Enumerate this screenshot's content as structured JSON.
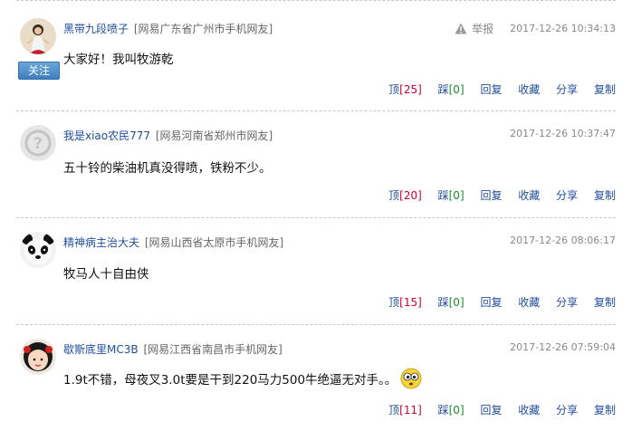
{
  "comments": [
    {
      "username": "黑带九段喷子",
      "location": "[网易广东省广州市手机网友]",
      "timestamp": "2017-12-26 10:34:13",
      "report_label": "举报",
      "follow_label": "关注",
      "text": "大家好！我叫牧游乾",
      "avatar_icon": "dancer-avatar-icon",
      "actions": {
        "up_label": "顶",
        "up_count": "[25]",
        "down_label": "踩",
        "down_count": "[0]",
        "reply_label": "回复",
        "fav_label": "收藏",
        "share_label": "分享",
        "copy_label": "复制"
      }
    },
    {
      "username": "我是xiao农民777",
      "location": "[网易河南省郑州市网友]",
      "timestamp": "2017-12-26 10:37:47",
      "text": "五十铃的柴油机真没得喷，铁粉不少。",
      "avatar_icon": "default-user-avatar-icon",
      "actions": {
        "up_label": "顶",
        "up_count": "[20]",
        "down_label": "踩",
        "down_count": "[0]",
        "reply_label": "回复",
        "fav_label": "收藏",
        "share_label": "分享",
        "copy_label": "复制"
      }
    },
    {
      "username": "精神病主治大夫",
      "location": "[网易山西省太原市手机网友]",
      "timestamp": "2017-12-26 08:06:17",
      "text": "牧马人十自由侠",
      "avatar_icon": "panda-avatar-icon",
      "actions": {
        "up_label": "顶",
        "up_count": "[15]",
        "down_label": "踩",
        "down_count": "[0]",
        "reply_label": "回复",
        "fav_label": "收藏",
        "share_label": "分享",
        "copy_label": "复制"
      }
    },
    {
      "username": "歇斯底里MC3B",
      "location": "[网易江西省南昌市手机网友]",
      "timestamp": "2017-12-26 07:59:04",
      "text": "1.9t不错，母夜叉3.0t要是干到220马力500牛绝逼无对手。。",
      "avatar_icon": "cartoon-girl-avatar-icon",
      "emoji_icon": "dizzy-face-emoji-icon",
      "actions": {
        "up_label": "顶",
        "up_count": "[11]",
        "down_label": "踩",
        "down_count": "[0]",
        "reply_label": "回复",
        "fav_label": "收藏",
        "share_label": "分享",
        "copy_label": "复制"
      }
    }
  ],
  "colors": {
    "username": "#1f4d9c",
    "up_count": "#cc0033",
    "down_count": "#1a8a2a",
    "follow_button": "#3f7fbf",
    "divider": "#c8c8c8"
  }
}
